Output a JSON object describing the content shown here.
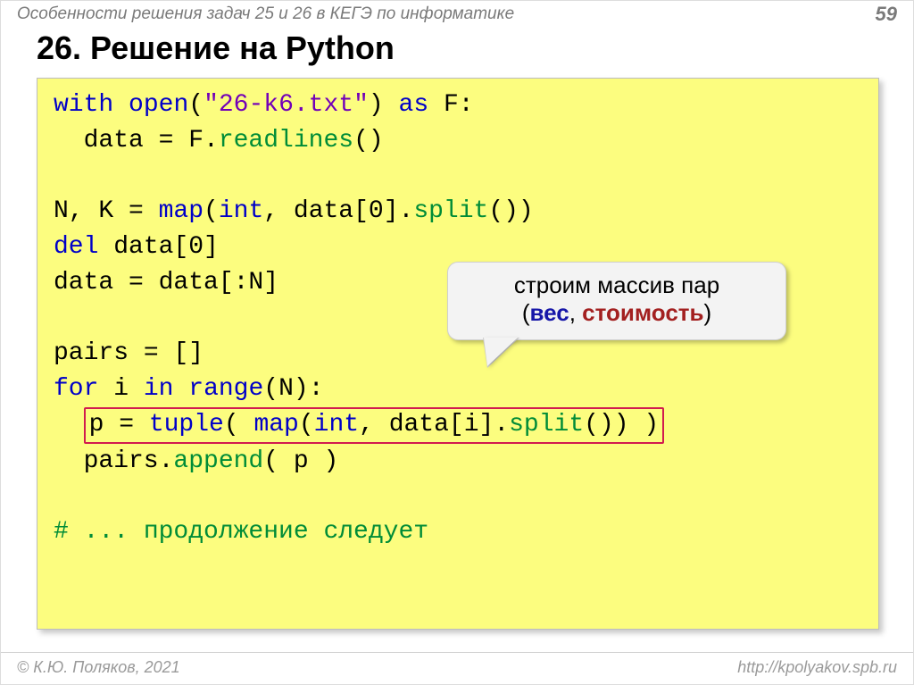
{
  "header": {
    "doc_title": "Особенности решения задач 25 и 26 в КЕГЭ по информатике",
    "page_number": "59"
  },
  "title": "26. Решение на Python",
  "code": {
    "l1_kw_with": "with",
    "l1_fn_open": "open",
    "l1_paren_open": "(",
    "l1_str": "\"26-k6.txt\"",
    "l1_paren_close": ")",
    "l1_kw_as": "as",
    "l1_var_F": " F:",
    "l2_txt": "data = F.",
    "l2_mth": "readlines",
    "l2_rest": "()",
    "l4_left": "N, K = ",
    "l4_fn_map": "map",
    "l4_mid": "(",
    "l4_fn_int": "int",
    "l4_mid2": ", data[0].",
    "l4_mth_split": "split",
    "l4_rest": "())",
    "l5_kw_del": "del",
    "l5_rest": " data[0]",
    "l6_txt": "data = data[:N]",
    "l8_txt": "pairs = []",
    "l9_kw_for": "for",
    "l9_mid1": " i ",
    "l9_kw_in": "in",
    "l9_sp": " ",
    "l9_fn_range": "range",
    "l9_rest": "(N):",
    "l10_lead": "p = ",
    "l10_fn_tuple": "tuple",
    "l10_mid": "( ",
    "l10_fn_map": "map",
    "l10_mid2": "(",
    "l10_fn_int": "int",
    "l10_mid3": ", data[i].",
    "l10_mth_split": "split",
    "l10_rest": "()) )",
    "l11_txt": "pairs.",
    "l11_mth_append": "append",
    "l11_rest": "( p )",
    "l13_cmt": "# ... продолжение следует"
  },
  "callout": {
    "line1": "строим массив пар",
    "p2_open": "(",
    "p2_w": "вес",
    "p2_sep": ", ",
    "p2_c": "стоимость",
    "p2_close": ")"
  },
  "footer": {
    "left": "© К.Ю. Поляков, 2021",
    "right": "http://kpolyakov.spb.ru"
  }
}
